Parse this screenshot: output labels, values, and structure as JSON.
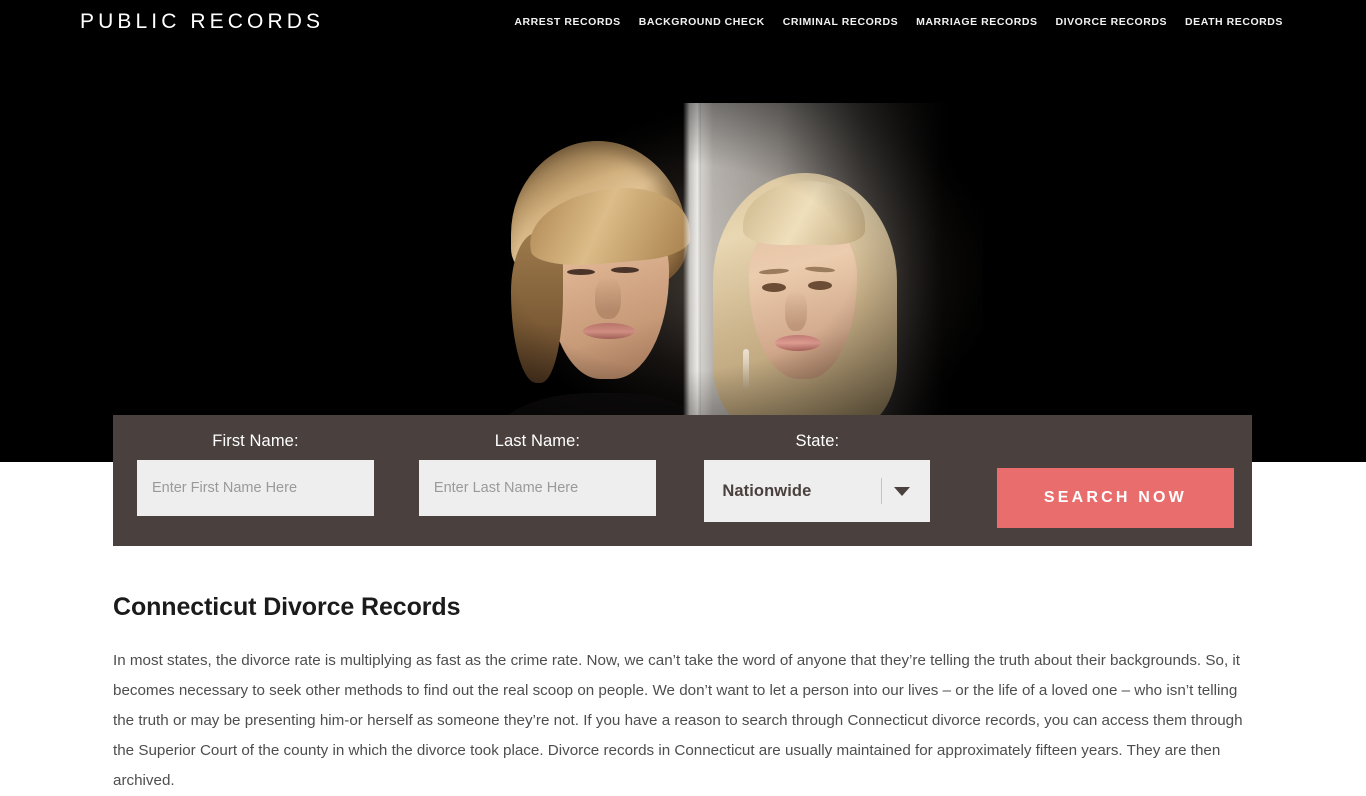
{
  "header": {
    "logo": "PUBLIC RECORDS",
    "nav": [
      {
        "label": "ARREST RECORDS"
      },
      {
        "label": "BACKGROUND CHECK"
      },
      {
        "label": "CRIMINAL RECORDS"
      },
      {
        "label": "MARRIAGE RECORDS"
      },
      {
        "label": "DIVORCE RECORDS"
      },
      {
        "label": "DEATH RECORDS"
      }
    ]
  },
  "hero": {
    "image_alt": "couple separated by a wall, man on left and woman on right, both looking down",
    "background_color": "#000000"
  },
  "search_form": {
    "background_color": "#4a403e",
    "first_name": {
      "label": "First Name:",
      "placeholder": "Enter First Name Here",
      "value": ""
    },
    "last_name": {
      "label": "Last Name:",
      "placeholder": "Enter Last Name Here",
      "value": ""
    },
    "state": {
      "label": "State:",
      "selected": "Nationwide"
    },
    "submit": {
      "label": "SEARCH NOW",
      "color": "#e96d6d"
    }
  },
  "article": {
    "title": "Connecticut Divorce Records",
    "body": "In most states, the divorce rate is multiplying as fast as the crime rate. Now, we can’t take the word of anyone that they’re telling the truth about their backgrounds. So, it becomes necessary to seek other methods to find out the real scoop on people. We don’t want to let a person into our lives – or the life of a loved one – who isn’t telling the truth or may be presenting him-or herself as someone they’re not. If you have a reason to search through Connecticut divorce records, you can access them through the Superior Court of the county in which the divorce took place. Divorce records in Connecticut are usually maintained for approximately fifteen years. They are then archived."
  }
}
